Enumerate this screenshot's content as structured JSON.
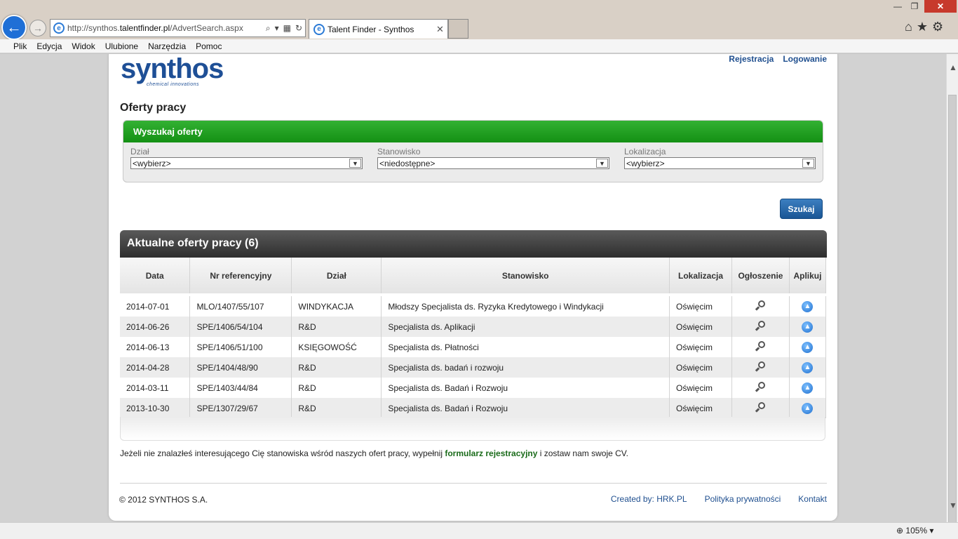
{
  "browser": {
    "url_prefix": "http://synthos.",
    "url_domain": "talentfinder.pl",
    "url_path": "/AdvertSearch.aspx",
    "tab_title": "Talent Finder - Synthos",
    "menu": [
      "Plik",
      "Edycja",
      "Widok",
      "Ulubione",
      "Narzędzia",
      "Pomoc"
    ],
    "zoom": "105%"
  },
  "header": {
    "logo_main": "synthos",
    "logo_sub": "chemical innovations",
    "register_link": "Rejestracja",
    "login_link": "Logowanie"
  },
  "page_title": "Oferty pracy",
  "search": {
    "title": "Wyszukaj oferty",
    "fields": [
      {
        "label": "Dział",
        "value": "<wybierz>"
      },
      {
        "label": "Stanowisko",
        "value": "<niedostępne>"
      },
      {
        "label": "Lokalizacja",
        "value": "<wybierz>"
      }
    ],
    "button": "Szukaj"
  },
  "offers": {
    "title": "Aktualne oferty pracy (6)",
    "columns": [
      "Data",
      "Nr referencyjny",
      "Dział",
      "Stanowisko",
      "Lokalizacja",
      "Ogłoszenie",
      "Aplikuj"
    ],
    "rows": [
      {
        "date": "2014-07-01",
        "ref": "MLO/1407/55/107",
        "dept": "WINDYKACJA",
        "position": "Młodszy Specjalista ds. Ryzyka Kredytowego i Windykacji",
        "location": "Oświęcim"
      },
      {
        "date": "2014-06-26",
        "ref": "SPE/1406/54/104",
        "dept": "R&D",
        "position": "Specjalista ds. Aplikacji",
        "location": "Oświęcim"
      },
      {
        "date": "2014-06-13",
        "ref": "SPE/1406/51/100",
        "dept": "KSIĘGOWOŚĆ",
        "position": "Specjalista ds. Płatności",
        "location": "Oświęcim"
      },
      {
        "date": "2014-04-28",
        "ref": "SPE/1404/48/90",
        "dept": "R&D",
        "position": "Specjalista ds. badań i rozwoju",
        "location": "Oświęcim"
      },
      {
        "date": "2014-03-11",
        "ref": "SPE/1403/44/84",
        "dept": "R&D",
        "position": "Specjalista ds. Badań i Rozwoju",
        "location": "Oświęcim"
      },
      {
        "date": "2013-10-30",
        "ref": "SPE/1307/29/67",
        "dept": "R&D",
        "position": "Specjalista ds. Badań i Rozwoju",
        "location": "Oświęcim"
      }
    ]
  },
  "note": {
    "before": "Jeżeli nie znalazłeś interesującego Cię stanowiska wśród naszych ofert pracy, wypełnij ",
    "link": "formularz rejestracyjny",
    "after": " i zostaw nam swoje CV."
  },
  "footer": {
    "copyright": "© 2012 SYNTHOS S.A.",
    "created_by": "Created by: HRK.PL",
    "privacy": "Polityka prywatności",
    "contact": "Kontakt"
  }
}
